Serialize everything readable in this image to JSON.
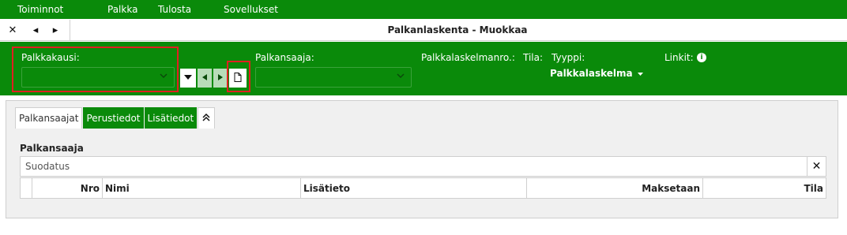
{
  "menu": {
    "items": [
      {
        "label": "Toiminnot"
      },
      {
        "label": "Palkka"
      },
      {
        "label": "Tulosta"
      },
      {
        "label": "Sovellukset"
      }
    ]
  },
  "titlebar": {
    "close_glyph": "✕",
    "prev_glyph": "◂",
    "next_glyph": "▸",
    "title": "Palkanlaskenta - Muokkaa"
  },
  "header": {
    "palkkakausi_label": "Palkkakausi:",
    "palkkakausi_value": "",
    "palkansaaja_label": "Palkansaaja:",
    "palkansaaja_value": "",
    "laskelmanro_label": "Palkkalaskelmanro.:",
    "tila_label": "Tila:",
    "tyyppi_label": "Tyyppi:",
    "tyyppi_value": "Palkkalaskelma",
    "linkit_label": "Linkit:",
    "info_glyph": "i"
  },
  "tabs": [
    {
      "label": "Palkansaajat",
      "active": true
    },
    {
      "label": "Perustiedot",
      "active": false
    },
    {
      "label": "Lisätiedot",
      "active": false
    }
  ],
  "collapse_glyph": "︽",
  "section": {
    "title": "Palkansaaja",
    "filter_placeholder": "Suodatus",
    "clear_glyph": "✕"
  },
  "table": {
    "columns": [
      "",
      "Nro",
      "Nimi",
      "Lisätieto",
      "Maksetaan",
      "Tila"
    ]
  },
  "colors": {
    "brand_green": "#0a8a0a",
    "highlight_red": "#e02020"
  },
  "icons": [
    "close-icon",
    "prev-icon",
    "next-icon",
    "chevron-down-icon",
    "caret-down-icon",
    "document-icon",
    "info-icon",
    "collapse-icon"
  ]
}
